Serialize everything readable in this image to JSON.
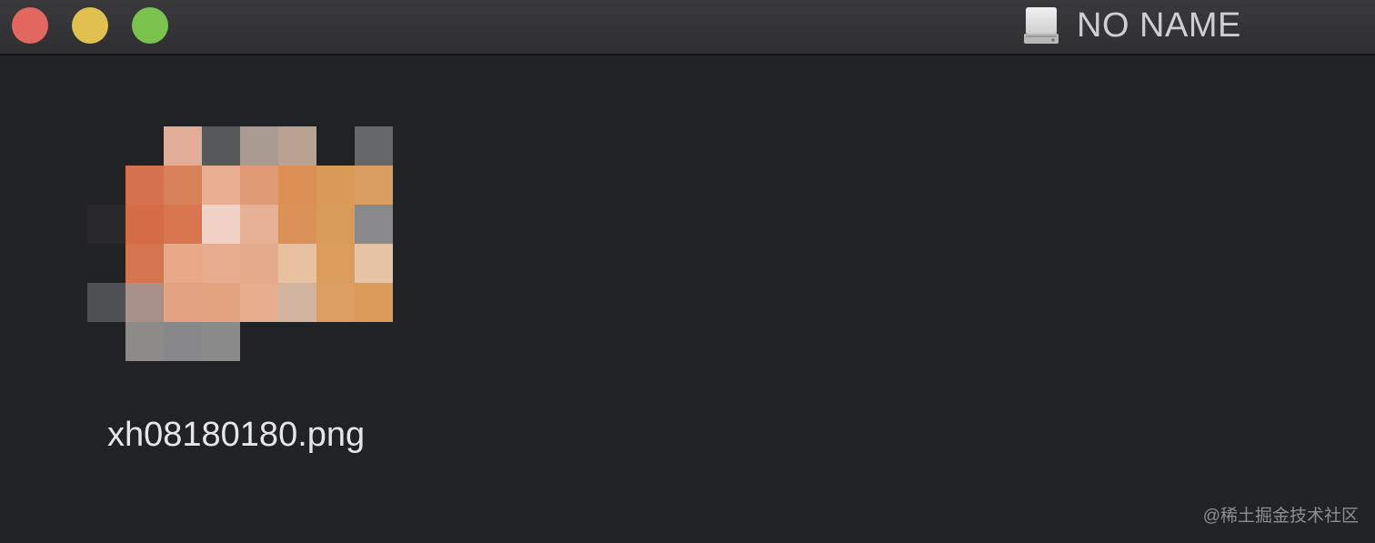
{
  "window": {
    "title": "NO NAME",
    "title_icon": "hard-drive-icon"
  },
  "traffic_lights": {
    "close_color": "#e2675e",
    "minimize_color": "#e0c04f",
    "zoom_color": "#7bc24e"
  },
  "files": [
    {
      "name": "xh08180180.png",
      "icon": "pixelated-image-thumbnail"
    }
  ],
  "watermark": "@稀土掘金技术社区"
}
